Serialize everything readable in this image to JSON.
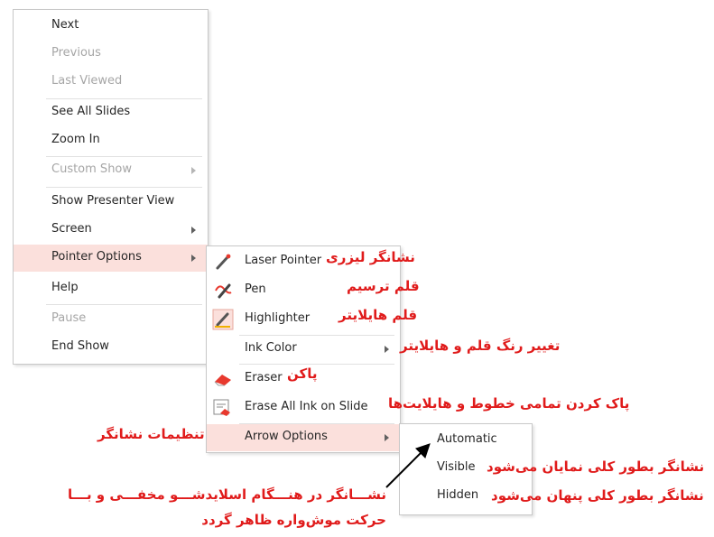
{
  "main_menu": {
    "items": [
      {
        "label": "Next",
        "disabled": false
      },
      {
        "label": "Previous",
        "disabled": true
      },
      {
        "label": "Last Viewed",
        "disabled": true
      },
      {
        "label": "See All Slides",
        "disabled": false
      },
      {
        "label": "Zoom In",
        "disabled": false
      },
      {
        "label": "Custom Show",
        "disabled": true
      },
      {
        "label": "Show Presenter View",
        "disabled": false
      },
      {
        "label": "Screen",
        "disabled": false
      },
      {
        "label": "Pointer Options",
        "disabled": false,
        "highlighted": true
      },
      {
        "label": "Help",
        "disabled": false
      },
      {
        "label": "Pause",
        "disabled": true
      },
      {
        "label": "End Show",
        "disabled": false
      }
    ]
  },
  "pointer_menu": {
    "items": [
      {
        "label": "Laser Pointer",
        "icon": "laser-pointer-icon"
      },
      {
        "label": "Pen",
        "icon": "pen-icon"
      },
      {
        "label": "Highlighter",
        "icon": "highlighter-icon"
      },
      {
        "label": "Ink Color",
        "icon": ""
      },
      {
        "label": "Eraser",
        "icon": "eraser-icon"
      },
      {
        "label": "Erase All Ink on Slide",
        "icon": "erase-all-ink-icon"
      },
      {
        "label": "Arrow Options",
        "icon": "",
        "highlighted": true
      }
    ]
  },
  "arrow_menu": {
    "items": [
      {
        "label": "Automatic"
      },
      {
        "label": "Visible"
      },
      {
        "label": "Hidden"
      }
    ]
  },
  "annotations": {
    "laser": "نشانگر لیزری",
    "pen": "قلم ترسیم",
    "highlighter": "قلم هایلایتر",
    "ink_color": "تغییر رنگ قلم و هایلایتر",
    "eraser": "پاکن",
    "erase_all": "پاک کردن تمامی خطوط و هایلایت‌ها",
    "arrow_options": "تنظیمات نشانگر",
    "visible": "نشانگر بطور کلی نمایان می‌شود",
    "hidden": "نشانگر بطور کلی پنهان می‌شود",
    "automatic_line1": "نشـــانگر در هنـــگام اسلایدشـــو مخفـــی و بـــا",
    "automatic_line2": "حرکت موش‌واره ظاهر گردد"
  },
  "colors": {
    "highlight_bg": "#fbe0dc",
    "annotation": "#e01b1b",
    "disabled_text": "#a6a6a6"
  }
}
